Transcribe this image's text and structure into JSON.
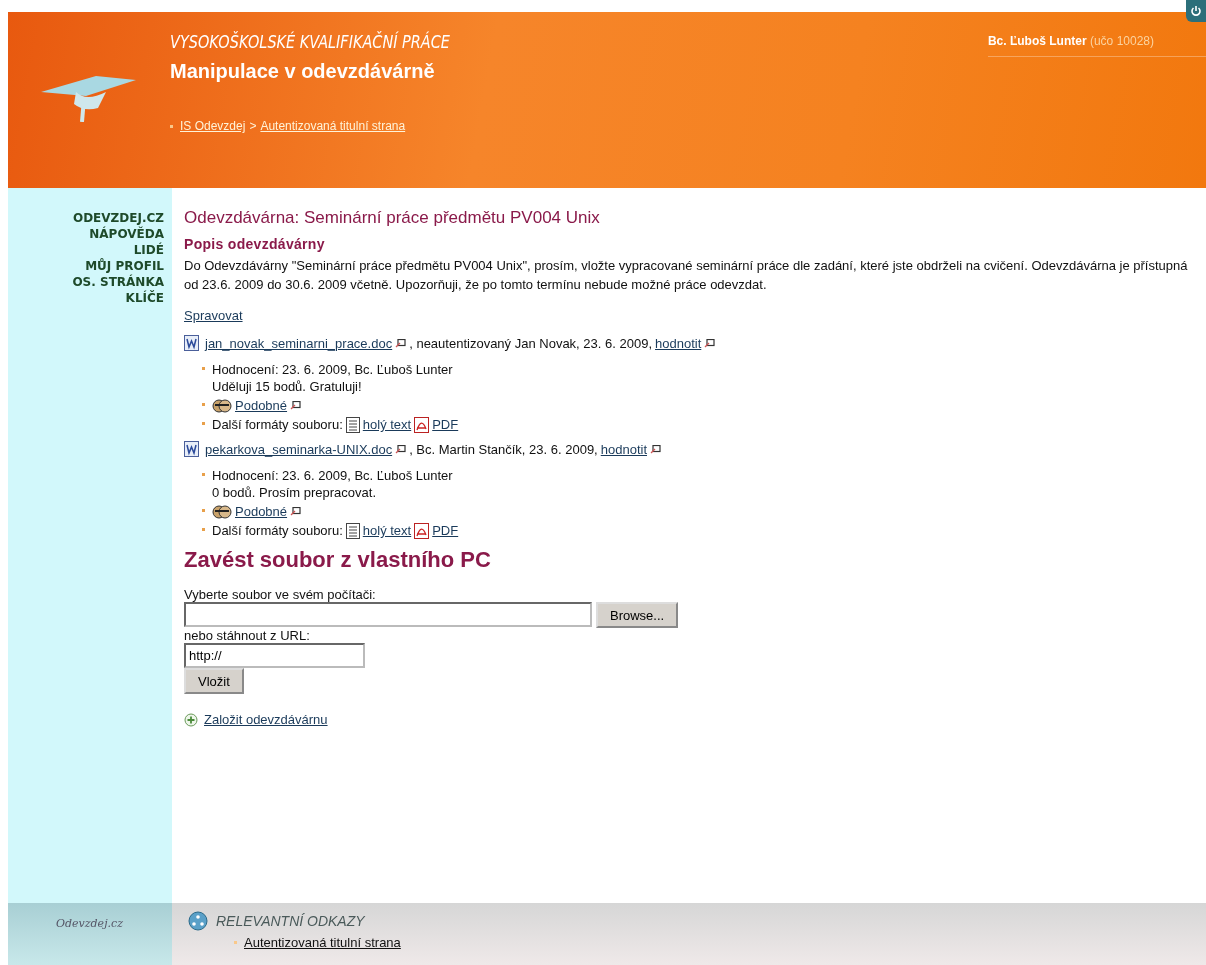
{
  "header": {
    "subtitle": "VYSOKOŠKOLSKÉ KVALIFIKAČNÍ PRÁCE",
    "title": "Manipulace v odevzdávárně",
    "user_name": "Bc. Ľuboš Lunter",
    "user_id": "(učo 10028)",
    "breadcrumb": [
      {
        "label": "IS Odevzdej"
      },
      {
        "label": "Autentizovaná titulní strana"
      }
    ],
    "separator": ">"
  },
  "sidebar": {
    "items": [
      {
        "label": "ODEVZDEJ.CZ"
      },
      {
        "label": "NÁPOVĚDA"
      },
      {
        "label": "LIDÉ"
      },
      {
        "label": "MŮJ PROFIL"
      },
      {
        "label": "OS. STRÁNKA"
      },
      {
        "label": "KLÍČE"
      }
    ]
  },
  "main": {
    "heading": "Odevzdávárna: Seminární práce předmětu PV004 Unix",
    "subheading": "Popis odevzdávárny",
    "description": "Do Odevzdávárny \"Seminární práce předmětu PV004 Unix\", prosím, vložte vypracované seminární práce dle zadání, které jste obdrželi na cvičení. Odevzdávárna je přístupná od 23.6. 2009 do 30.6. 2009 včetně. Upozorňuji, že po tomto termínu nebude možné práce odevzdat.",
    "manage_link": "Spravovat",
    "files": [
      {
        "name": "jan_novak_seminarni_prace.doc",
        "info": ", neautentizovaný Jan Novak, 23. 6. 2009,",
        "rate_link": "hodnotit",
        "rating_header": "Hodnocení: 23. 6. 2009, Bc. Ľuboš Lunter",
        "rating_text": "Uděluji 15 bodů. Gratuluji!",
        "similar": "Podobné",
        "formats_label": "Další formáty souboru:",
        "formats": [
          {
            "kind": "text",
            "label": "holý text"
          },
          {
            "kind": "pdf",
            "label": "PDF"
          }
        ]
      },
      {
        "name": "pekarkova_seminarka-UNIX.doc",
        "info": ", Bc. Martin Stančík, 23. 6. 2009,",
        "rate_link": "hodnotit",
        "rating_header": "Hodnocení: 23. 6. 2009, Bc. Ľuboš Lunter",
        "rating_text": "0 bodů. Prosím prepracovat.",
        "similar": "Podobné",
        "formats_label": "Další formáty souboru:",
        "formats": [
          {
            "kind": "text",
            "label": "holý text"
          },
          {
            "kind": "pdf",
            "label": "PDF"
          }
        ]
      }
    ]
  },
  "upload": {
    "heading": "Zavést soubor z vlastního PC",
    "file_label": "Vyberte soubor ve svém počítači:",
    "browse": "Browse...",
    "url_label": "nebo stáhnout z URL:",
    "url_value": "http://",
    "submit": "Vložit",
    "create_link": "Založit odevzdávárnu"
  },
  "footer": {
    "brand": "Odevzdej.cz",
    "heading": "RELEVANTNÍ ODKAZY",
    "links": [
      "Autentizovaná titulní strana"
    ]
  }
}
